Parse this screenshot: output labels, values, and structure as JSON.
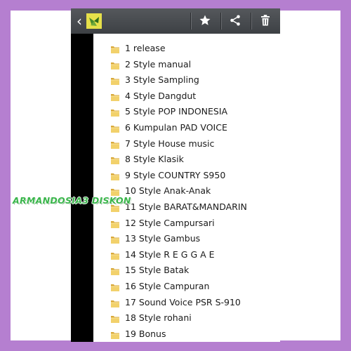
{
  "toolbar": {
    "back_icon": "chevron-left-icon",
    "app_icon": "gallery-app-icon",
    "favorite_icon": "star-icon",
    "share_icon": "share-icon",
    "delete_icon": "trash-icon",
    "color": "#4a4d51"
  },
  "files": [
    {
      "name": "1 release"
    },
    {
      "name": "2 Style manual"
    },
    {
      "name": "3 Style Sampling"
    },
    {
      "name": "4 Style Dangdut"
    },
    {
      "name": "5 Style POP INDONESIA"
    },
    {
      "name": "6 Kumpulan PAD VOICE"
    },
    {
      "name": "7 Style House music"
    },
    {
      "name": "8 Style Klasik"
    },
    {
      "name": "9 Style COUNTRY S950"
    },
    {
      "name": "10 Style Anak-Anak"
    },
    {
      "name": "11 Style BARAT&MANDARIN"
    },
    {
      "name": "12 Style Campursari"
    },
    {
      "name": "13 Style Gambus"
    },
    {
      "name": "14 Style R E G G A E"
    },
    {
      "name": "15 Style Batak"
    },
    {
      "name": "16 Style Campuran"
    },
    {
      "name": "17 Sound Voice PSR S-910"
    },
    {
      "name": "18 Style rohani"
    },
    {
      "name": "19 Bonus"
    }
  ],
  "folder_icon": "folder-icon",
  "watermark": "ARMANDOSIA3 DISKON",
  "colors": {
    "border": "#b57fd0",
    "watermark": "#39b54a",
    "folder": "#e8c25a"
  }
}
